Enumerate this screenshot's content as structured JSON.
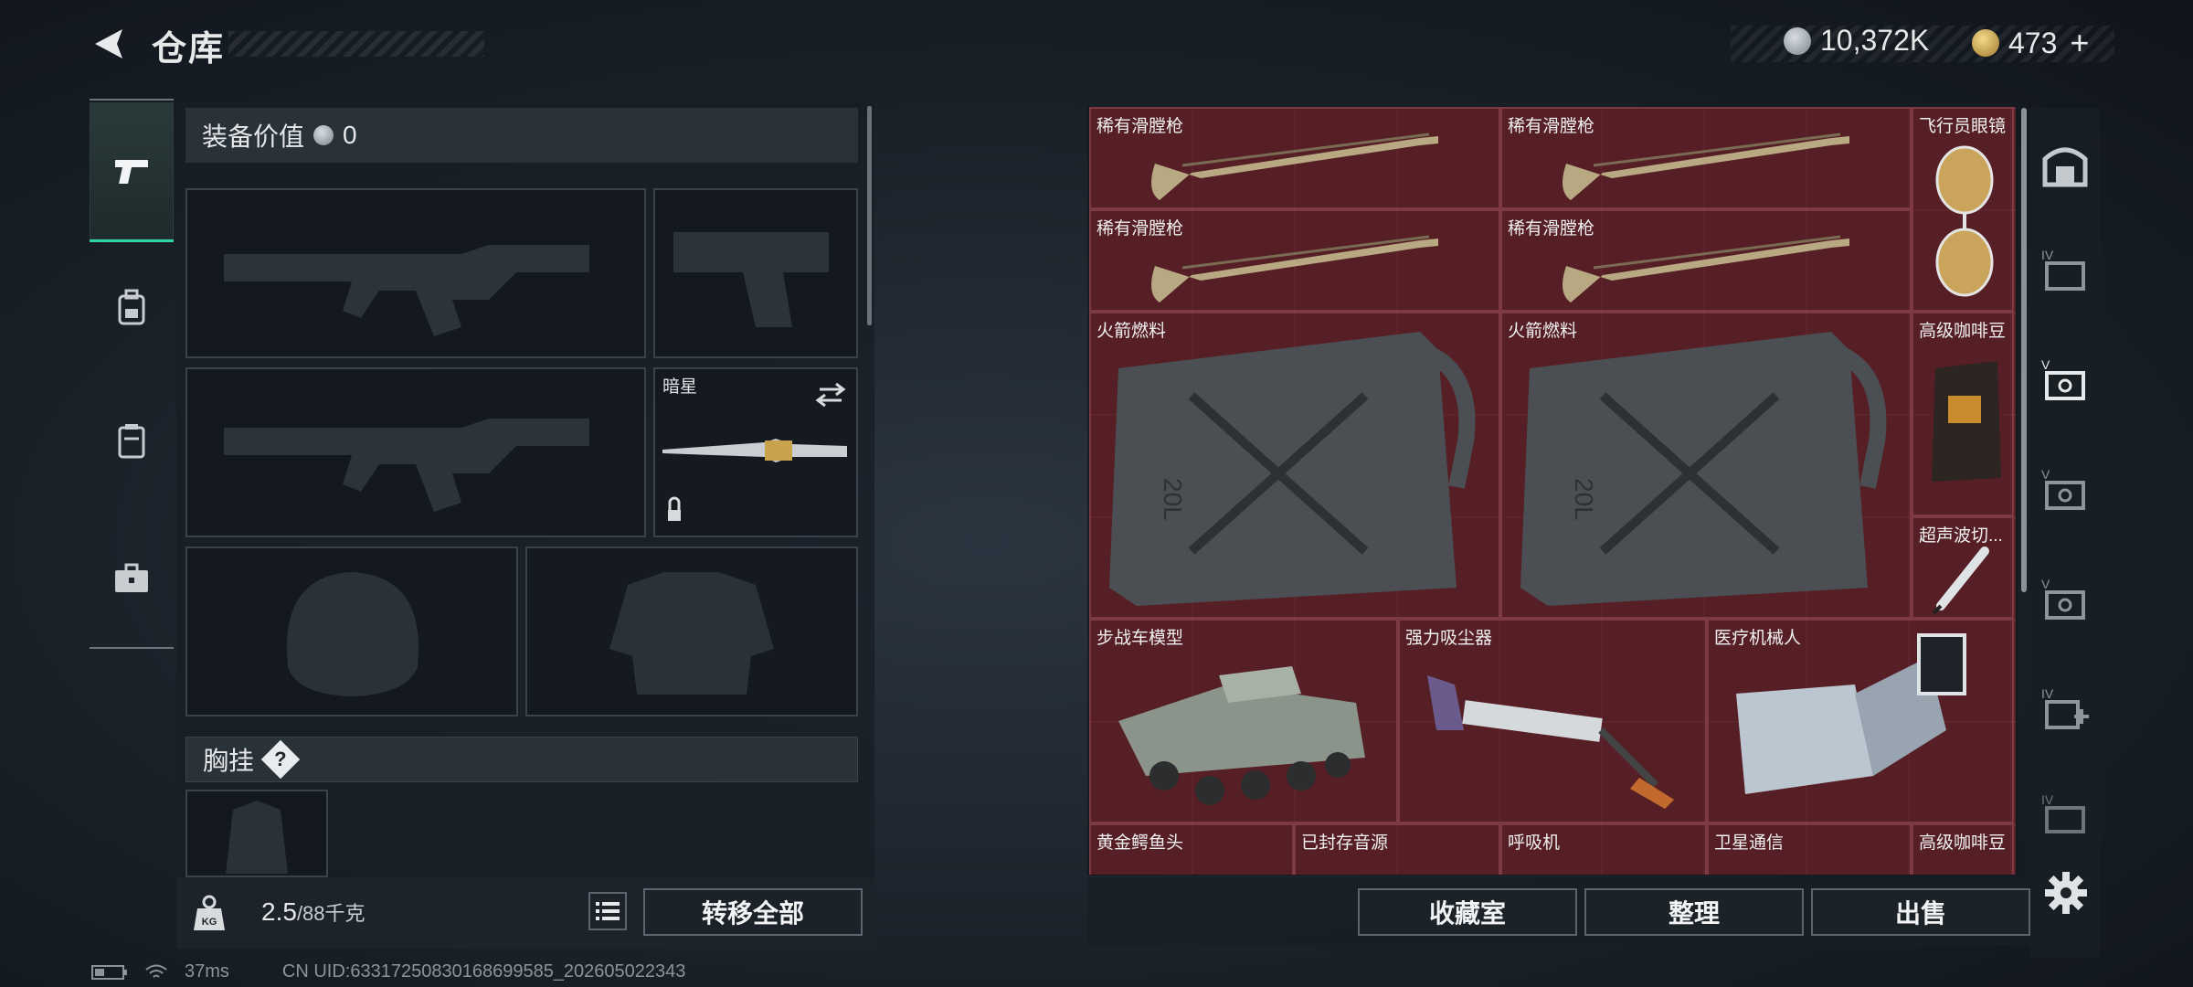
{
  "header": {
    "title": "仓库",
    "currency_silver": "10,372K",
    "currency_gold": "473",
    "plus_label": "+"
  },
  "left_tabs": [
    {
      "icon": "pistol-icon",
      "active": true
    },
    {
      "icon": "backpack-icon",
      "active": false
    },
    {
      "icon": "vest-icon",
      "active": false
    },
    {
      "icon": "briefcase-icon",
      "active": false
    }
  ],
  "loadout": {
    "value_label": "装备价值",
    "value_amount": "0",
    "melee_name": "暗星",
    "chest_rig_label": "胸挂",
    "help_label": "?",
    "weight_current": "2.5",
    "weight_max": "/88千克",
    "transfer_all": "转移全部"
  },
  "storage": {
    "items": [
      {
        "name": "稀有滑膛枪",
        "icon": "musket-icon"
      },
      {
        "name": "稀有滑膛枪",
        "icon": "musket-icon"
      },
      {
        "name": "飞行员眼镜",
        "icon": "aviator-glasses-icon"
      },
      {
        "name": "稀有滑膛枪",
        "icon": "musket-icon"
      },
      {
        "name": "稀有滑膛枪",
        "icon": "musket-icon"
      },
      {
        "name": "火箭燃料",
        "icon": "jerrycan-icon"
      },
      {
        "name": "火箭燃料",
        "icon": "jerrycan-icon"
      },
      {
        "name": "高级咖啡豆",
        "icon": "coffee-bag-icon"
      },
      {
        "name": "超声波切...",
        "icon": "ultrasonic-cutter-icon"
      },
      {
        "name": "步战车模型",
        "icon": "ifv-model-icon"
      },
      {
        "name": "强力吸尘器",
        "icon": "vacuum-icon"
      },
      {
        "name": "医疗机械人",
        "icon": "medical-robot-icon"
      },
      {
        "name": "黄金鳄鱼头",
        "icon": "gold-croc-icon"
      },
      {
        "name": "已封存音源",
        "icon": "sound-source-icon"
      },
      {
        "name": "呼吸机",
        "icon": "ventilator-icon"
      },
      {
        "name": "卫星通信",
        "icon": "satellite-icon"
      },
      {
        "name": "高级咖啡豆",
        "icon": "coffee-bag-icon"
      }
    ],
    "jerrycan_text": "20L"
  },
  "right_tabs": [
    {
      "icon": "safe-box-icon"
    },
    {
      "icon": "storage-iv-icon",
      "tier": "IV"
    },
    {
      "icon": "storage-v-icon",
      "tier": "V"
    },
    {
      "icon": "storage-v-icon",
      "tier": "V"
    },
    {
      "icon": "storage-v-icon",
      "tier": "V"
    },
    {
      "icon": "storage-iv-plus-icon",
      "tier": "IV"
    },
    {
      "icon": "storage-iv-icon",
      "tier": "IV"
    }
  ],
  "actions": {
    "collection": "收藏室",
    "sort": "整理",
    "sell": "出售"
  },
  "status": {
    "ping": "37ms",
    "uid": "CN UID:6331725083016869958​5_202605022343"
  },
  "colors": {
    "accent": "#2fd3a8",
    "storage_bg": "#5a2228",
    "panel_bg": "#191f26"
  }
}
